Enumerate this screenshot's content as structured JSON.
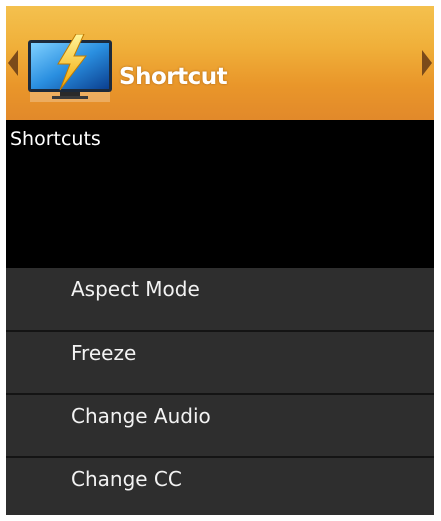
{
  "header": {
    "title": "Shortcut",
    "icon": "tv-lightning-icon"
  },
  "info": {
    "title": "Shortcuts"
  },
  "menu": {
    "items": [
      {
        "label": "Aspect Mode"
      },
      {
        "label": "Freeze"
      },
      {
        "label": "Change Audio"
      },
      {
        "label": "Change CC"
      }
    ]
  },
  "colors": {
    "header_top": "#f4c14e",
    "header_bottom": "#e2892a",
    "info_bg": "#000000",
    "item_bg": "#2e2e2e",
    "text": "#ffffff"
  }
}
